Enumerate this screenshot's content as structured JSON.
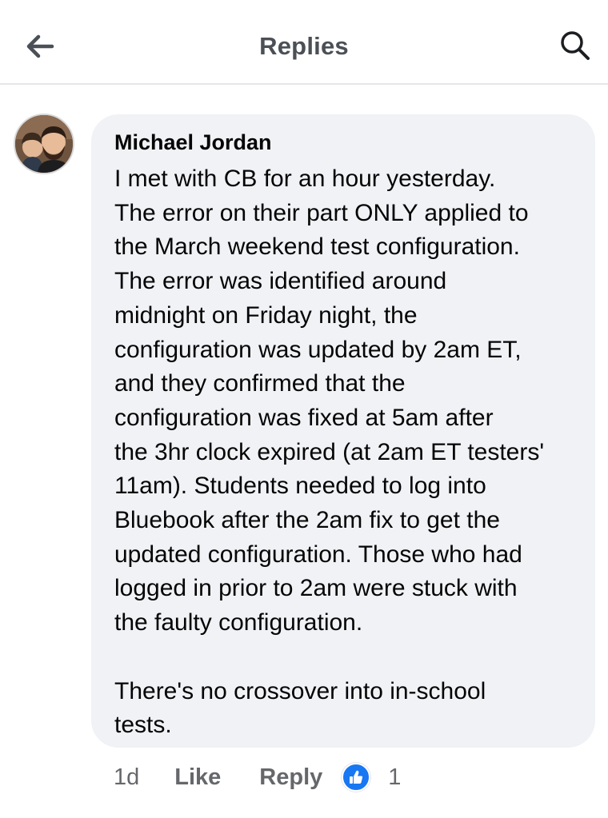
{
  "header": {
    "title": "Replies",
    "back_icon": "arrow-left-icon",
    "search_icon": "search-icon"
  },
  "comment": {
    "author": "Michael Jordan",
    "paragraphs": [
      "I met with CB for an hour yesterday.\nThe error on their part ONLY applied to\nthe March weekend test configuration.\nThe error was identified around\nmidnight on Friday night, the\nconfiguration was updated by 2am ET,\nand they confirmed that the\nconfiguration was fixed at 5am after\nthe 3hr clock expired (at 2am ET testers'\n11am). Students needed to log into\nBluebook after the 2am fix to get the\nupdated configuration. Those who had\nlogged in prior to 2am were stuck with\nthe faulty configuration.",
      "There's no crossover into in-school\ntests."
    ]
  },
  "actions": {
    "time": "1d",
    "like_label": "Like",
    "reply_label": "Reply",
    "reaction_icon": "thumbs-up-icon",
    "reaction_count": "1"
  },
  "colors": {
    "bubble": "#f0f2f5",
    "reaction_blue": "#1877f2",
    "secondary_text": "#65676b"
  }
}
